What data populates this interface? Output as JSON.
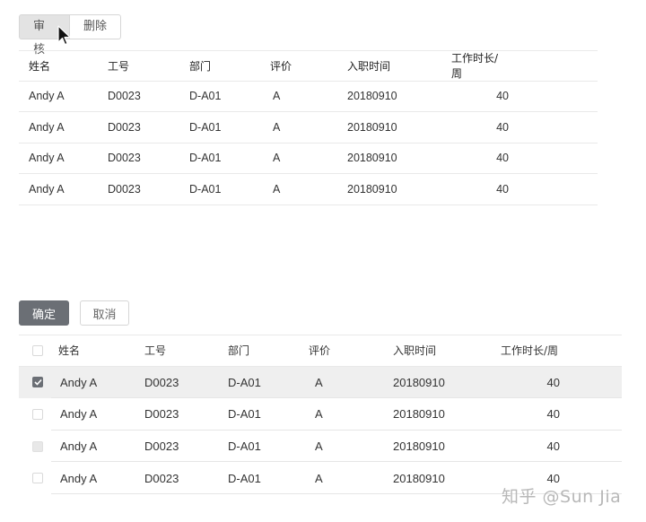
{
  "top_actions": {
    "review_label": "审核",
    "delete_label": "删除"
  },
  "table1": {
    "headers": [
      "姓名",
      "工号",
      "部门",
      "评价",
      "入职时间",
      "工作时长/周"
    ],
    "rows": [
      [
        "Andy A",
        "D0023",
        "D-A01",
        "A",
        "20180910",
        "40"
      ],
      [
        "Andy A",
        "D0023",
        "D-A01",
        "A",
        "20180910",
        "40"
      ],
      [
        "Andy A",
        "D0023",
        "D-A01",
        "A",
        "20180910",
        "40"
      ],
      [
        "Andy A",
        "D0023",
        "D-A01",
        "A",
        "20180910",
        "40"
      ]
    ]
  },
  "bottom_actions": {
    "confirm_label": "确定",
    "cancel_label": "取消"
  },
  "table2": {
    "headers": [
      "姓名",
      "工号",
      "部门",
      "评价",
      "入职时间",
      "工作时长/周"
    ],
    "rows": [
      [
        "Andy A",
        "D0023",
        "D-A01",
        "A",
        "20180910",
        "40"
      ],
      [
        "Andy A",
        "D0023",
        "D-A01",
        "A",
        "20180910",
        "40"
      ],
      [
        "Andy A",
        "D0023",
        "D-A01",
        "A",
        "20180910",
        "40"
      ],
      [
        "Andy A",
        "D0023",
        "D-A01",
        "A",
        "20180910",
        "40"
      ]
    ],
    "row_states": [
      "checked",
      "unchecked",
      "disabled",
      "unchecked"
    ],
    "header_checkbox": "unchecked"
  },
  "watermark": "知乎 @Sun Jia",
  "colors": {
    "primary_button": "#6b6f75",
    "selected_row": "#efefef",
    "border": "#e9e9e9"
  }
}
